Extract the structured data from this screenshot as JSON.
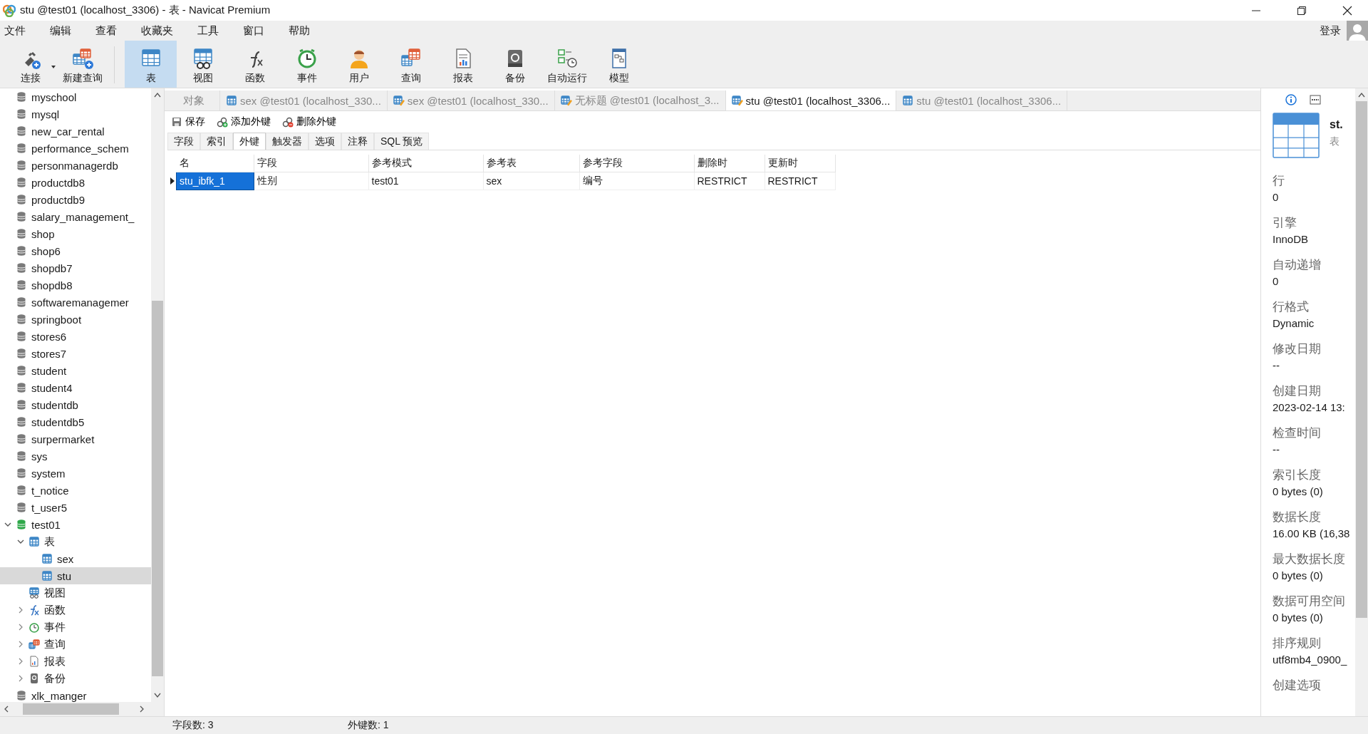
{
  "window": {
    "title": "stu @test01 (localhost_3306) - 表 - Navicat Premium"
  },
  "menu": [
    "文件",
    "编辑",
    "查看",
    "收藏夹",
    "工具",
    "窗口",
    "帮助"
  ],
  "login": "登录",
  "toolbar": [
    {
      "label": "连接",
      "kind": "connect",
      "selected": false,
      "dropdown": true
    },
    {
      "label": "新建查询",
      "kind": "newquery",
      "selected": false
    },
    {
      "label": "表",
      "kind": "table",
      "selected": true
    },
    {
      "label": "视图",
      "kind": "view",
      "selected": false
    },
    {
      "label": "函数",
      "kind": "function",
      "selected": false
    },
    {
      "label": "事件",
      "kind": "event",
      "selected": false
    },
    {
      "label": "用户",
      "kind": "user",
      "selected": false
    },
    {
      "label": "查询",
      "kind": "query",
      "selected": false
    },
    {
      "label": "报表",
      "kind": "report",
      "selected": false
    },
    {
      "label": "备份",
      "kind": "backup",
      "selected": false
    },
    {
      "label": "自动运行",
      "kind": "autorun",
      "selected": false
    },
    {
      "label": "模型",
      "kind": "model",
      "selected": false
    }
  ],
  "sidebar": {
    "items": [
      {
        "label": "myschool",
        "kind": "db",
        "selected": false
      },
      {
        "label": "mysql",
        "kind": "db",
        "selected": false
      },
      {
        "label": "new_car_rental",
        "kind": "db",
        "selected": false
      },
      {
        "label": "performance_schem",
        "kind": "db",
        "selected": false
      },
      {
        "label": "personmanagerdb",
        "kind": "db",
        "selected": false
      },
      {
        "label": "productdb8",
        "kind": "db",
        "selected": false
      },
      {
        "label": "productdb9",
        "kind": "db",
        "selected": false
      },
      {
        "label": "salary_management_",
        "kind": "db",
        "selected": false
      },
      {
        "label": "shop",
        "kind": "db",
        "selected": false
      },
      {
        "label": "shop6",
        "kind": "db",
        "selected": false
      },
      {
        "label": "shopdb7",
        "kind": "db",
        "selected": false
      },
      {
        "label": "shopdb8",
        "kind": "db",
        "selected": false
      },
      {
        "label": "softwaremanagemer",
        "kind": "db",
        "selected": false
      },
      {
        "label": "springboot",
        "kind": "db",
        "selected": false
      },
      {
        "label": "stores6",
        "kind": "db",
        "selected": false
      },
      {
        "label": "stores7",
        "kind": "db",
        "selected": false
      },
      {
        "label": "student",
        "kind": "db",
        "selected": false
      },
      {
        "label": "student4",
        "kind": "db",
        "selected": false
      },
      {
        "label": "studentdb",
        "kind": "db",
        "selected": false
      },
      {
        "label": "studentdb5",
        "kind": "db",
        "selected": false
      },
      {
        "label": "surpermarket",
        "kind": "db",
        "selected": false
      },
      {
        "label": "sys",
        "kind": "db",
        "selected": false
      },
      {
        "label": "system",
        "kind": "db",
        "selected": false
      },
      {
        "label": "t_notice",
        "kind": "db",
        "selected": false
      },
      {
        "label": "t_user5",
        "kind": "db",
        "selected": false
      },
      {
        "label": "test01",
        "kind": "db-open",
        "selected": false,
        "expanded": true,
        "children": [
          {
            "label": "表",
            "kind": "tables",
            "selected": false,
            "expanded": true,
            "children": [
              {
                "label": "sex",
                "kind": "table",
                "selected": false
              },
              {
                "label": "stu",
                "kind": "table",
                "selected": true
              }
            ]
          },
          {
            "label": "视图",
            "kind": "views",
            "selected": false
          },
          {
            "label": "函数",
            "kind": "functions",
            "selected": false,
            "expanded": false
          },
          {
            "label": "事件",
            "kind": "events",
            "selected": false,
            "expanded": false
          },
          {
            "label": "查询",
            "kind": "queries",
            "selected": false,
            "expanded": false
          },
          {
            "label": "报表",
            "kind": "reports",
            "selected": false,
            "expanded": false
          },
          {
            "label": "备份",
            "kind": "backups",
            "selected": false,
            "expanded": false
          }
        ]
      },
      {
        "label": "xlk_manger",
        "kind": "db",
        "selected": false
      }
    ]
  },
  "tabs": [
    {
      "label": "对象",
      "kind": "objects",
      "selected": false
    },
    {
      "label": "sex @test01 (localhost_330...",
      "kind": "table",
      "selected": false
    },
    {
      "label": "sex @test01 (localhost_330...",
      "kind": "design",
      "selected": false
    },
    {
      "label": "无标题 @test01 (localhost_3...",
      "kind": "design",
      "selected": false
    },
    {
      "label": "stu @test01 (localhost_3306...",
      "kind": "design",
      "selected": true
    },
    {
      "label": "stu @test01 (localhost_3306...",
      "kind": "table",
      "selected": false
    }
  ],
  "actions": [
    {
      "label": "保存",
      "kind": "save"
    },
    {
      "label": "添加外键",
      "kind": "add"
    },
    {
      "label": "删除外键",
      "kind": "delete"
    }
  ],
  "subtabs": [
    {
      "label": "字段",
      "selected": false
    },
    {
      "label": "索引",
      "selected": false
    },
    {
      "label": "外键",
      "selected": true
    },
    {
      "label": "触发器",
      "selected": false
    },
    {
      "label": "选项",
      "selected": false
    },
    {
      "label": "注释",
      "selected": false
    },
    {
      "label": "SQL 预览",
      "selected": false
    }
  ],
  "table": {
    "columns": [
      "名",
      "字段",
      "参考模式",
      "参考表",
      "参考字段",
      "删除时",
      "更新时"
    ],
    "rows": [
      {
        "current": true,
        "cells": [
          "stu_ibfk_1",
          "性别",
          "test01",
          "sex",
          "编号",
          "RESTRICT",
          "RESTRICT"
        ]
      }
    ]
  },
  "info": {
    "name": "st.",
    "type": "表",
    "properties": [
      {
        "label": "行",
        "value": "0"
      },
      {
        "label": "引擎",
        "value": "InnoDB"
      },
      {
        "label": "自动递增",
        "value": "0"
      },
      {
        "label": "行格式",
        "value": "Dynamic"
      },
      {
        "label": "修改日期",
        "value": "--"
      },
      {
        "label": "创建日期",
        "value": "2023-02-14 13:"
      },
      {
        "label": "检查时间",
        "value": "--"
      },
      {
        "label": "索引长度",
        "value": "0 bytes (0)"
      },
      {
        "label": "数据长度",
        "value": "16.00 KB (16,38"
      },
      {
        "label": "最大数据长度",
        "value": "0 bytes (0)"
      },
      {
        "label": "数据可用空间",
        "value": "0 bytes (0)"
      },
      {
        "label": "排序规则",
        "value": "utf8mb4_0900_"
      },
      {
        "label": "创建选项"
      }
    ]
  },
  "status_bar": [
    "字段数: 3",
    "外键数: 1"
  ]
}
